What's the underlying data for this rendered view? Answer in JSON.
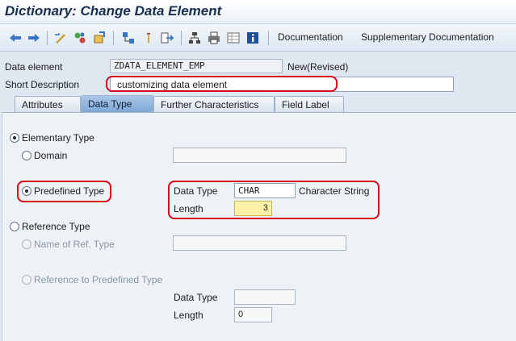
{
  "window": {
    "title": "Dictionary: Change Data Element"
  },
  "toolbar": {
    "icons": [
      "back-arrow-icon",
      "forward-arrow-icon",
      "display-change-icon",
      "other-object-icon",
      "activate-icon",
      "where-used-icon",
      "object-list-icon",
      "navigation-icon",
      "hierarchy-icon",
      "print-icon",
      "display-layout-icon",
      "info-icon"
    ],
    "documentation_label": "Documentation",
    "supplementary_label": "Supplementary Documentation"
  },
  "header": {
    "data_element_label": "Data element",
    "data_element_value": "ZDATA_ELEMENT_EMP",
    "status": "New(Revised)",
    "short_description_label": "Short Description",
    "short_description_value": "customizing data element"
  },
  "tabs": [
    {
      "label": "Attributes",
      "active": false
    },
    {
      "label": "Data Type",
      "active": true
    },
    {
      "label": "Further Characteristics",
      "active": false
    },
    {
      "label": "Field Label",
      "active": false
    }
  ],
  "elementary": {
    "label": "Elementary Type",
    "selected": true,
    "domain": {
      "label": "Domain",
      "value": ""
    },
    "predefined": {
      "label": "Predefined Type",
      "selected": true,
      "data_type_label": "Data Type",
      "data_type_value": "CHAR",
      "data_type_text": "Character String",
      "length_label": "Length",
      "length_value": "3"
    }
  },
  "reference": {
    "label": "Reference Type",
    "selected": false,
    "name_of_ref": {
      "label": "Name of Ref. Type",
      "value": ""
    },
    "ref_predefined": {
      "label": "Reference to Predefined Type",
      "data_type_label": "Data Type",
      "data_type_value": "",
      "length_label": "Length",
      "length_value": "0"
    }
  },
  "colors": {
    "highlight": "#d8061b",
    "active_tab": "#7ea8d6",
    "length_field": "#fdf2a8"
  }
}
